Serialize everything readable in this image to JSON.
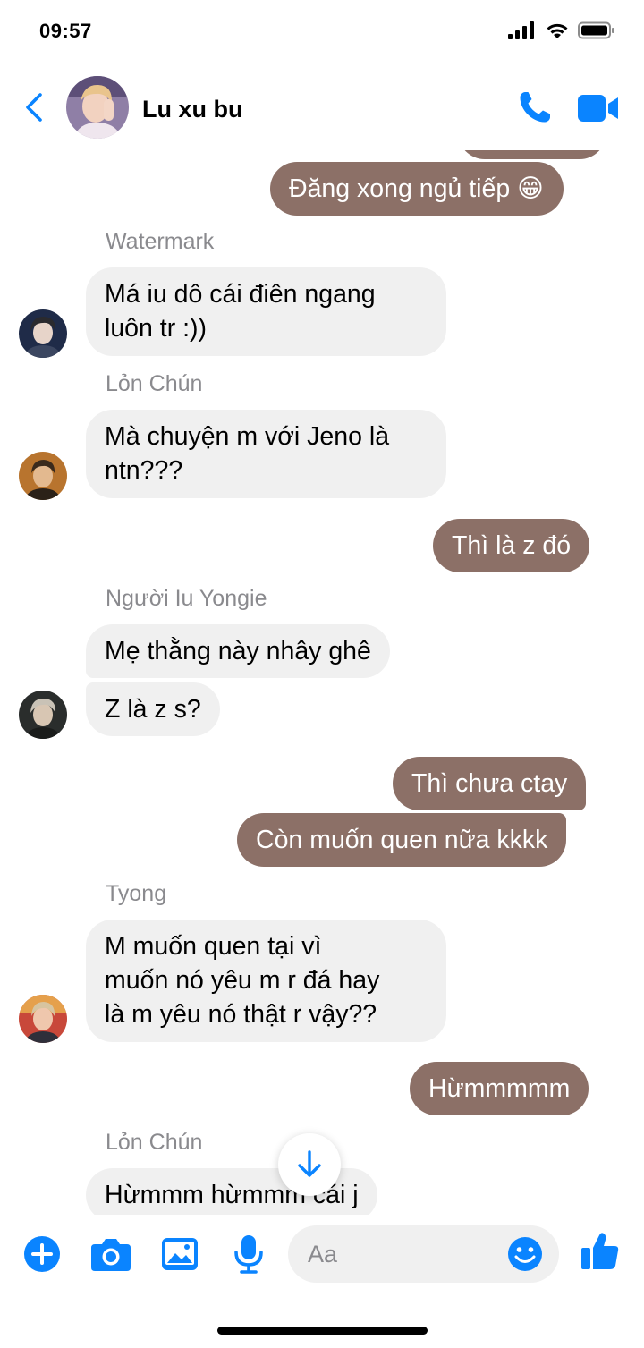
{
  "status_bar": {
    "time": "09:57"
  },
  "header": {
    "contact_name": "Lu xu bu"
  },
  "messages": [
    {
      "text": "Đăng xong ngủ tiếp 😁"
    },
    {
      "sender": "Watermark"
    },
    {
      "line1": "Má iu dô cái điên ngang",
      "line2": "luôn tr :))"
    },
    {
      "sender": "Lỏn Chún"
    },
    {
      "line1": "Mà chuyện m với Jeno là",
      "line2": "ntn???"
    },
    {
      "text": "Thì là z đó"
    },
    {
      "sender": "Người Iu Yongie"
    },
    {
      "text": "Mẹ thằng này nhây ghê"
    },
    {
      "text": "Z là z s?"
    },
    {
      "text": "Thì chưa ctay"
    },
    {
      "text": "Còn muốn quen nữa kkkk"
    },
    {
      "sender": "Tyong"
    },
    {
      "line1": "M muốn quen tại vì",
      "line2": "muốn nó yêu m r đá hay",
      "line3": "là m yêu nó thật r vậy??"
    },
    {
      "text": "Hừmmmmm"
    },
    {
      "sender": "Lỏn Chún"
    },
    {
      "text": "Hừmmm hừmmm cái j"
    }
  ],
  "composer": {
    "placeholder": "Aa"
  },
  "colors": {
    "accent": "#0a84ff",
    "outgoing_bubble": "#8c7067",
    "incoming_bubble": "#f0f0f0"
  },
  "icons": [
    "back-chevron-icon",
    "phone-icon",
    "video-camera-icon",
    "plus-icon",
    "camera-icon",
    "image-icon",
    "microphone-icon",
    "emoji-icon",
    "thumbs-up-icon",
    "arrow-down-icon"
  ]
}
